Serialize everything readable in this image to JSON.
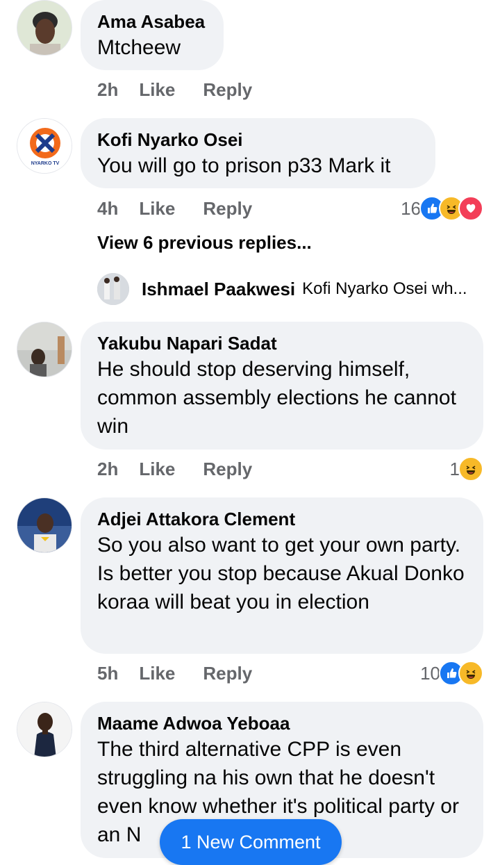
{
  "comments": [
    {
      "author": "Ama Asabea",
      "text": "Mtcheew",
      "time": "2h",
      "like_label": "Like",
      "reply_label": "Reply"
    },
    {
      "author": "Kofi Nyarko Osei",
      "text": "You will go to prison p33 Mark it",
      "time": "4h",
      "like_label": "Like",
      "reply_label": "Reply",
      "reaction_count": "16",
      "reactions": [
        "like-icon",
        "haha-icon",
        "love-icon"
      ],
      "avatar_logo_text": "NYARKO TV"
    },
    {
      "author": "Yakubu Napari Sadat",
      "text": "He should stop deserving himself, common assembly elections he cannot win",
      "time": "2h",
      "like_label": "Like",
      "reply_label": "Reply",
      "reaction_count": "1",
      "reactions": [
        "haha-icon"
      ]
    },
    {
      "author": "Adjei Attakora Clement",
      "text": "So you also want to get your own party. Is better you stop because Akual Donko koraa will beat you in election",
      "time": "5h",
      "like_label": "Like",
      "reply_label": "Reply",
      "reaction_count": "10",
      "reactions": [
        "like-icon",
        "haha-icon"
      ]
    },
    {
      "author": "Maame Adwoa Yeboaa",
      "text": "The third alternative CPP is even struggling na his own that he doesn't even know whether it's political party or an N"
    }
  ],
  "view_previous_replies": "View 6 previous replies...",
  "reply_preview": {
    "author": "Ishmael Paakwesi",
    "text": "Kofi Nyarko Osei wh..."
  },
  "new_comment_button": "1 New Comment",
  "colors": {
    "bubble": "#f0f2f5",
    "meta": "#65676b",
    "accent": "#1877f2",
    "haha": "#f7b928",
    "love": "#f33e58"
  }
}
